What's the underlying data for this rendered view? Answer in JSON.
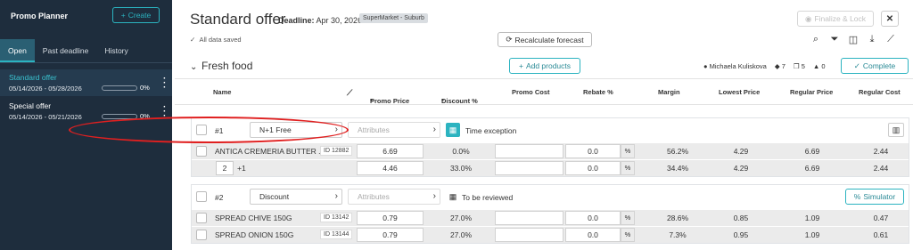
{
  "sidebar": {
    "title": "Promo Planner",
    "create_label": "Create",
    "tabs": [
      {
        "label": "Open",
        "active": true
      },
      {
        "label": "Past deadline",
        "active": false
      },
      {
        "label": "History",
        "active": false
      }
    ],
    "offers": [
      {
        "name": "Standard offer",
        "dates": "05/14/2026 - 05/28/2026",
        "progress": "0%",
        "selected": true
      },
      {
        "name": "Special offer",
        "dates": "05/14/2026 - 05/21/2026",
        "progress": "0%",
        "selected": false
      }
    ]
  },
  "header": {
    "title": "Standard offer",
    "deadline_label": "Deadline:",
    "deadline_value": "Apr 30, 2026",
    "tag": "SuperMarket - Suburb",
    "saved_status": "All data saved",
    "recalc_label": "Recalculate forecast",
    "finalize_label": "Finalize & Lock",
    "close_label": "✕"
  },
  "section": {
    "title": "Fresh food",
    "add_products_label": "Add products",
    "user": "Michaela Kuliskova",
    "tag_count": "7",
    "copy_count": "5",
    "warning_count": "0",
    "complete_label": "Complete"
  },
  "columns": {
    "name": "Name",
    "promo_price": "Promo Price",
    "discount": "Discount %",
    "promo_cost": "Promo Cost",
    "rebate": "Rebate %",
    "margin": "Margin",
    "lowest_price": "Lowest Price",
    "regular_price": "Regular Price",
    "regular_cost": "Regular Cost"
  },
  "groups": [
    {
      "number": "#1",
      "mechanic": "N+1 Free",
      "attributes_placeholder": "Attributes",
      "time_label": "Time exception",
      "rows": [
        {
          "name": "ANTICA CREMERIA BUTTER ...",
          "id": "ID 12882",
          "promo_price": "6.69",
          "discount": "0.0%",
          "promo_cost": "",
          "rebate": "0.0",
          "pct": "%",
          "margin": "56.2%",
          "lowest_price": "4.29",
          "regular_price": "6.69",
          "regular_cost": "2.44"
        },
        {
          "qty": "2",
          "plus": "+1",
          "promo_price": "4.46",
          "discount": "33.0%",
          "promo_cost": "",
          "rebate": "0.0",
          "pct": "%",
          "margin": "34.4%",
          "lowest_price": "4.29",
          "regular_price": "6.69",
          "regular_cost": "2.44"
        }
      ]
    },
    {
      "number": "#2",
      "mechanic": "Discount",
      "attributes_placeholder": "Attributes",
      "time_label": "To be reviewed",
      "simulator_label": "Simulator",
      "rows": [
        {
          "name": "SPREAD CHIVE 150G",
          "id": "ID 13142",
          "promo_price": "0.79",
          "discount": "27.0%",
          "promo_cost": "",
          "rebate": "0.0",
          "pct": "%",
          "margin": "28.6%",
          "lowest_price": "0.85",
          "regular_price": "1.09",
          "regular_cost": "0.47"
        },
        {
          "name": "SPREAD ONION 150G",
          "id": "ID 13144",
          "promo_price": "0.79",
          "discount": "27.0%",
          "promo_cost": "",
          "rebate": "0.0",
          "pct": "%",
          "margin": "7.3%",
          "lowest_price": "0.95",
          "regular_price": "1.09",
          "regular_cost": "0.61"
        }
      ]
    }
  ],
  "colors": {
    "sidebar_bg": "#1e2d3d",
    "accent": "#2bb3c0",
    "highlight_ring": "#e02020"
  }
}
